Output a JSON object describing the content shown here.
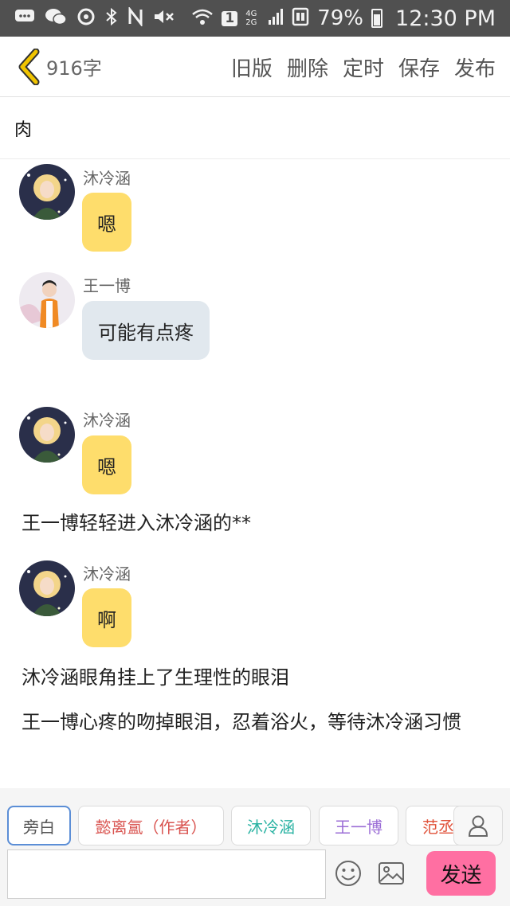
{
  "status_bar": {
    "battery": "79%",
    "time": "12:30 PM",
    "sim_badge": "1",
    "net": "4G 2G"
  },
  "header": {
    "word_count": "916字",
    "actions": [
      "旧版",
      "删除",
      "定时",
      "保存",
      "发布"
    ]
  },
  "doc_title": "肉",
  "messages": [
    {
      "speaker": "沐冷涵",
      "text": "嗯"
    },
    {
      "speaker": "王一博",
      "text": "可能有点疼"
    },
    {
      "speaker": "沐冷涵",
      "text": "嗯"
    },
    {
      "narration": "王一博轻轻进入沐冷涵的**"
    },
    {
      "speaker": "沐冷涵",
      "text": "啊"
    },
    {
      "narration": "沐冷涵眼角挂上了生理性的眼泪"
    },
    {
      "narration": "王一博心疼的吻掉眼泪，忍着浴火，等待沐冷涵习惯"
    }
  ],
  "roles": [
    {
      "label": "旁白",
      "color": "#555555"
    },
    {
      "label": "懿离氲（作者）",
      "color": "#d9534f"
    },
    {
      "label": "沐冷涵",
      "color": "#2bb3a3"
    },
    {
      "label": "王一博",
      "color": "#9b6dd6"
    },
    {
      "label": "范丞",
      "color": "#e0523a"
    }
  ],
  "composer": {
    "placeholder": "",
    "send_label": "发送"
  },
  "icons": [
    "back-arrow-icon",
    "emoji-icon",
    "image-icon",
    "profile-icon"
  ],
  "colors": {
    "accent_yellow": "#fedd6c",
    "bubble_grey": "#e1e8ee",
    "send_pink": "#ff6fa2",
    "back_arrow": "#f0c400"
  }
}
